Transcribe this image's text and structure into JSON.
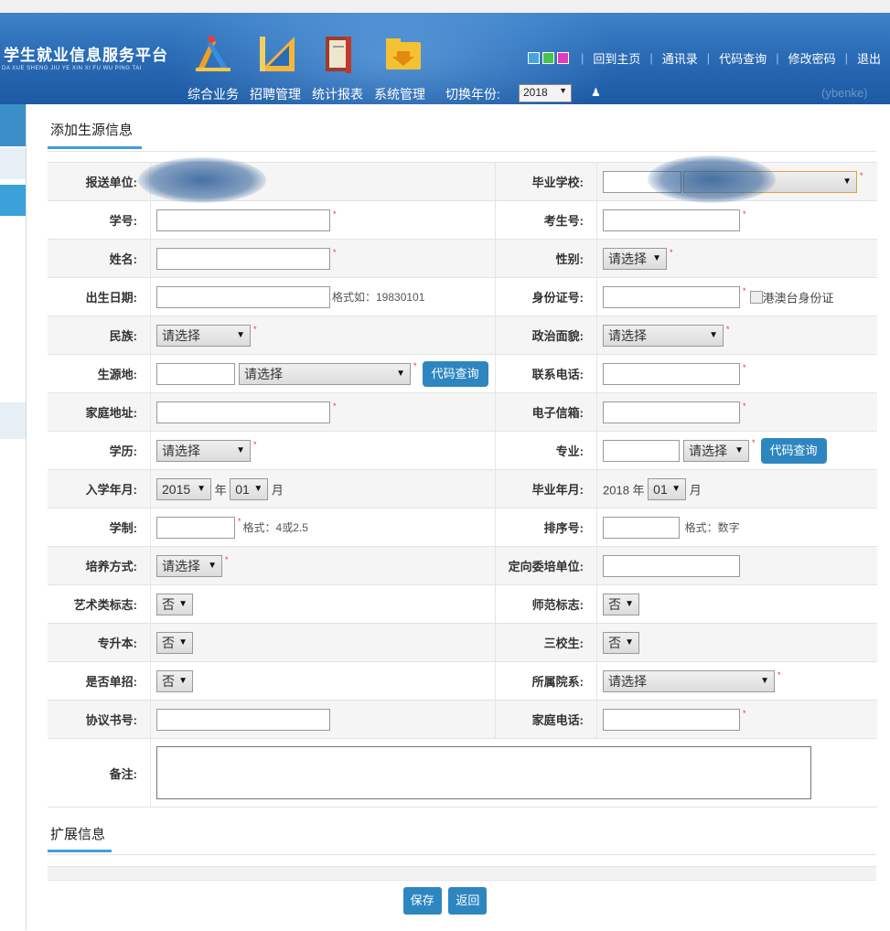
{
  "header": {
    "logo_cn": "学生就业信息服务平台",
    "logo_en": "DA XUE SHENG JIU YE XIN XI FU WU PING TAI",
    "nav": [
      "综合业务",
      "招聘管理",
      "统计报表",
      "系统管理"
    ],
    "year_label": "切换年份:",
    "year_value": "2018",
    "user_suffix": "(ybenke)",
    "links": [
      "回到主页",
      "通讯录",
      "代码查询",
      "修改密码",
      "退出"
    ],
    "skin_colors": [
      "#4aa3df",
      "#44c44a",
      "#e23ac2"
    ]
  },
  "section1": {
    "title": "添加生源信息"
  },
  "form": {
    "send_unit": {
      "label": "报送单位:"
    },
    "school": {
      "label": "毕业学校:"
    },
    "student_no": {
      "label": "学号:"
    },
    "exam_no": {
      "label": "考生号:"
    },
    "name": {
      "label": "姓名:"
    },
    "gender": {
      "label": "性别:",
      "value": "请选择"
    },
    "birth": {
      "label": "出生日期:",
      "hint": "格式如：19830101"
    },
    "idcard": {
      "label": "身份证号:",
      "check_label": "港澳台身份证"
    },
    "nation": {
      "label": "民族:",
      "value": "请选择"
    },
    "political": {
      "label": "政治面貌:",
      "value": "请选择"
    },
    "origin": {
      "label": "生源地:",
      "value": "请选择",
      "button": "代码查询"
    },
    "phone": {
      "label": "联系电话:"
    },
    "address": {
      "label": "家庭地址:"
    },
    "email": {
      "label": "电子信箱:"
    },
    "education": {
      "label": "学历:",
      "value": "请选择"
    },
    "major": {
      "label": "专业:",
      "value": "请选择",
      "button": "代码查询"
    },
    "enroll": {
      "label": "入学年月:",
      "year": "2015",
      "year_unit": "年",
      "month": "01",
      "month_unit": "月"
    },
    "graduate": {
      "label": "毕业年月:",
      "year_text": "2018 年",
      "month": "01",
      "month_unit": "月"
    },
    "length": {
      "label": "学制:",
      "hint": "格式：4或2.5"
    },
    "order": {
      "label": "排序号:",
      "hint": "格式：数字"
    },
    "train": {
      "label": "培养方式:",
      "value": "请选择"
    },
    "directed": {
      "label": "定向委培单位:"
    },
    "art": {
      "label": "艺术类标志:",
      "value": "否"
    },
    "normal": {
      "label": "师范标志:",
      "value": "否"
    },
    "upgrade": {
      "label": "专升本:",
      "value": "否"
    },
    "three": {
      "label": "三校生:",
      "value": "否"
    },
    "single": {
      "label": "是否单招:",
      "value": "否"
    },
    "dept": {
      "label": "所属院系:",
      "value": "请选择"
    },
    "agreement": {
      "label": "协议书号:"
    },
    "homephone": {
      "label": "家庭电话:"
    },
    "remarks": {
      "label": "备注:"
    }
  },
  "section2": {
    "title": "扩展信息"
  },
  "footer": {
    "save": "保存",
    "back": "返回"
  }
}
